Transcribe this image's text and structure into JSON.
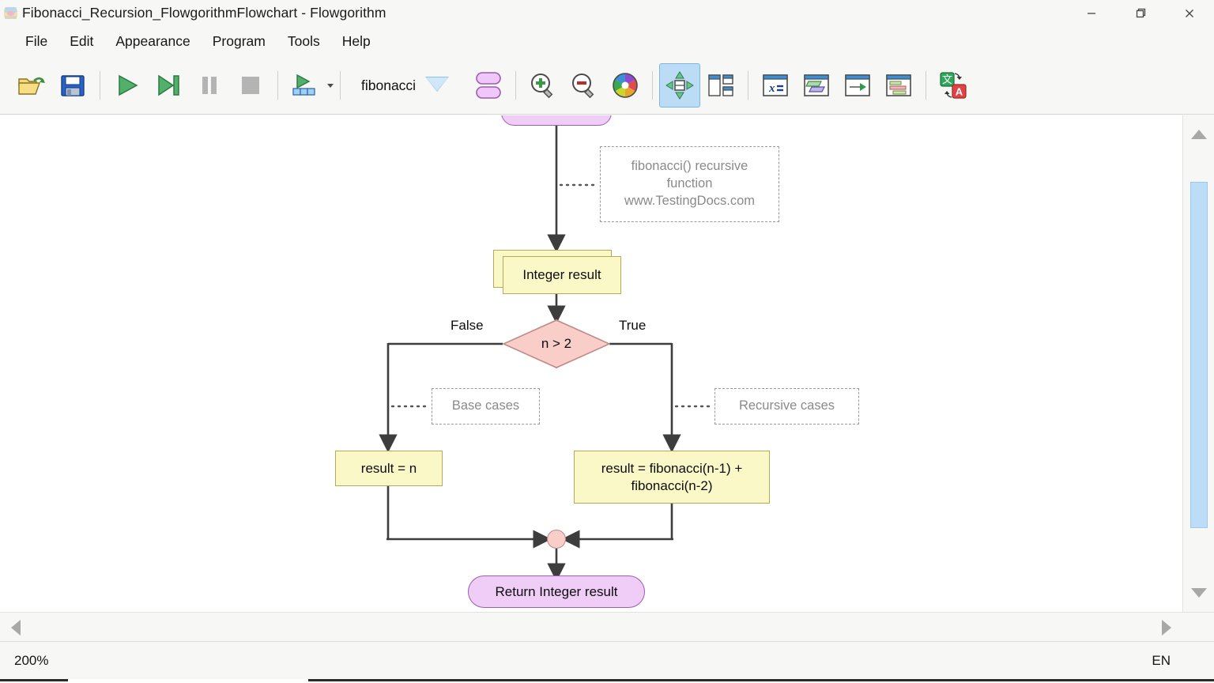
{
  "window": {
    "title": "Fibonacci_Recursion_FlowgorithmFlowchart - Flowgorithm",
    "app_icon": "flowgorithm-app-icon",
    "minimize_label": "–",
    "maximize_label": "❐",
    "close_label": "✕"
  },
  "menu": {
    "items": [
      {
        "label": "File"
      },
      {
        "label": "Edit"
      },
      {
        "label": "Appearance"
      },
      {
        "label": "Program"
      },
      {
        "label": "Tools"
      },
      {
        "label": "Help"
      }
    ]
  },
  "toolbar": {
    "open_icon": "open-folder-icon",
    "save_icon": "save-floppy-disk-icon",
    "run_icon": "run-play-icon",
    "step_icon": "step-forward-icon",
    "pause_icon": "pause-icon",
    "stop_icon": "stop-icon",
    "run_with_data_icon": "run-with-data-icon",
    "run_with_data_caret_icon": "caret-down-icon",
    "function_name": "fibonacci",
    "function_dropdown_icon": "dropdown-triangle-icon",
    "add_function_icon": "function-shapes-icon",
    "zoom_in_icon": "zoom-in-magnifier-icon",
    "zoom_out_icon": "zoom-out-magnifier-icon",
    "color_wheel_icon": "color-wheel-icon",
    "pan_tool_icon": "pan-move-icon",
    "split_view_icon": "split-view-icon",
    "variables_window_icon": "variables-window-icon",
    "io_window_icon": "io-window-icon",
    "console_window_icon": "console-window-icon",
    "source_window_icon": "source-code-window-icon",
    "translate_icon": "translate-icon"
  },
  "flowchart": {
    "nodes": {
      "top_partial": {
        "type": "terminal",
        "label": ""
      },
      "declare": {
        "type": "declare",
        "label": "Integer result"
      },
      "decision": {
        "type": "decision",
        "label": "n > 2"
      },
      "false_label": "False",
      "true_label": "True",
      "assign_left": {
        "type": "assign",
        "label": "result = n"
      },
      "assign_right": {
        "type": "assign",
        "label": "result = fibonacci(n-1) + fibonacci(n-2)"
      },
      "merge": {
        "type": "merge-point"
      },
      "return": {
        "type": "return",
        "label": "Return Integer result"
      }
    },
    "annotations": [
      {
        "id": "main",
        "text": "fibonacci() recursive function www.TestingDocs.com"
      },
      {
        "id": "base",
        "text": "Base cases"
      },
      {
        "id": "recursive",
        "text": "Recursive cases"
      }
    ]
  },
  "scrollbars": {
    "v_up_icon": "scroll-up-arrow-icon",
    "v_down_icon": "scroll-down-arrow-icon",
    "h_left_icon": "scroll-left-arrow-icon",
    "h_right_icon": "scroll-right-arrow-icon"
  },
  "status": {
    "zoom": "200%",
    "language": "EN"
  },
  "colors": {
    "node_yellow_fill": "#fbf8c8",
    "node_yellow_border": "#b3ab56",
    "node_pink_fill": "#f9cec9",
    "node_pink_border": "#c98f8b",
    "node_purple_fill": "#efcdf7",
    "node_purple_border": "#9a5fae",
    "connector": "#3d3d3d",
    "annotation_text": "#8a8a8a",
    "selected_tool": "#bcdcf5",
    "scrollbar_thumb": "#bcdcf8"
  }
}
